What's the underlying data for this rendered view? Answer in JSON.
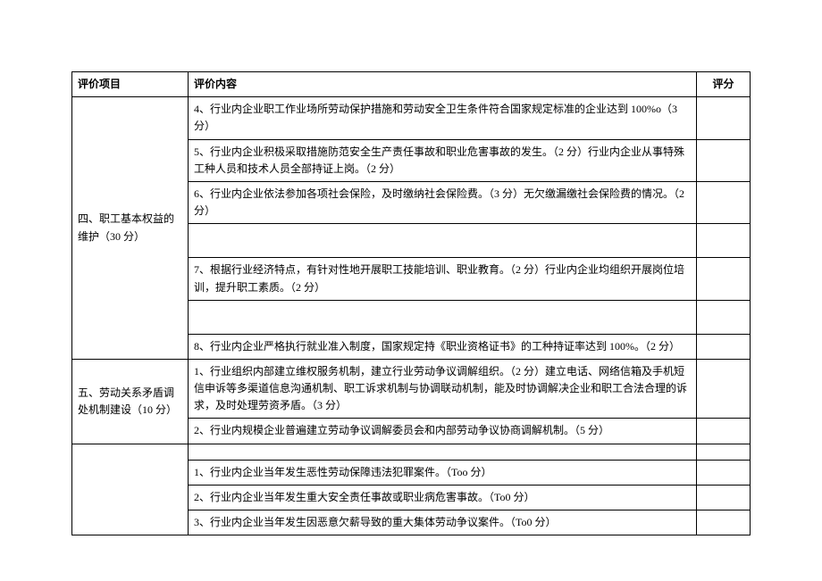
{
  "headers": {
    "item": "评价项目",
    "content": "评价内容",
    "score": "评分"
  },
  "sections": [
    {
      "name": "四、职工基本权益的维护（30 分）",
      "rows": [
        "4、行业内企业职工作业场所劳动保护措施和劳动安全卫生条件符合国家规定标准的企业达到 100%o（3 分）",
        "5、行业内企业积极采取措施防范安全生产责任事故和职业危害事故的发生。（2 分）行业内企业从事特殊工种人员和技术人员全部持证上岗。（2 分）",
        "6、行业内企业依法参加各项社会保险，及时缴纳社会保险费。（3 分）无欠缴漏缴社会保险费的情况。（2 分）",
        "",
        "7、根据行业经济特点，有针对性地开展职工技能培训、职业教育。（2 分）行业内企业均组织开展岗位培训，提升职工素质。（2 分）",
        "",
        "8、行业内企业严格执行就业准入制度，国家规定持《职业资格证书》的工种持证率达到 100%。（2 分）"
      ]
    },
    {
      "name": "五、劳动关系矛盾调处机制建设（10 分）",
      "rows": [
        "1、行业组织内部建立维权服务机制，建立行业劳动争议调解组织。（2 分）建立电话、网络信箱及手机短信申诉等多渠道信息沟通机制、职工诉求机制与协调联动机制，能及时协调解决企业和职工合法合理的诉求，及时处理劳资矛盾。（3 分）",
        "2、行业内规模企业普遍建立劳动争议调解委员会和内部劳动争议协商调解机制。（5 分）"
      ]
    },
    {
      "name": "",
      "rows": [
        "1、行业内企业当年发生恶性劳动保障违法犯罪案件。（Too 分）",
        "2、行业内企业当年发生重大安全责任事故或职业病危害事故。（To0 分）",
        "3、行业内企业当年发生因恶意欠薪导致的重大集体劳动争议案件。（To0 分）"
      ]
    }
  ]
}
